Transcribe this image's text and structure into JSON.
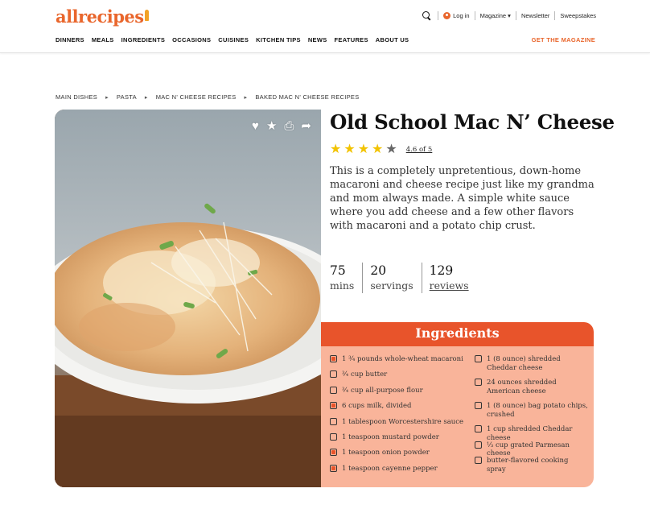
{
  "brand": {
    "logo_text": "allrecipes"
  },
  "top_links": {
    "login": "Log in",
    "magazine": "Magazine ▾",
    "newsletter": "Newsletter",
    "sweepstakes": "Sweepstakes"
  },
  "nav": [
    "DINNERS",
    "MEALS",
    "INGREDIENTS",
    "OCCASIONS",
    "CUISINES",
    "KITCHEN TIPS",
    "NEWS",
    "FEATURES",
    "ABOUT US"
  ],
  "get_magazine": "GET THE MAGAZINE",
  "breadcrumb": [
    "MAIN DISHES",
    "PASTA",
    "MAC N' CHEESE RECIPES",
    "BAKED MAC N' CHEESE RECIPES"
  ],
  "recipe": {
    "title": "Old School Mac N’ Cheese",
    "rating_value": 4.6,
    "rating_text": "4.6 of 5",
    "description": "This is a completely unpretentious, down-home macaroni and cheese recipe just like my grandma and mom always made. A simple white sauce where you add cheese and a few other flavors with macaroni and a potato chip crust.",
    "stats": [
      {
        "num": "75",
        "label": "mins"
      },
      {
        "num": "20",
        "label": "servings"
      },
      {
        "num": "129",
        "label": "reviews"
      }
    ]
  },
  "photo_actions": {
    "favorite": "heart-icon",
    "rate": "star-icon",
    "print": "print-icon",
    "share": "share-icon"
  },
  "ingredients": {
    "heading": "Ingredients",
    "left": [
      {
        "text": "1 ¾ pounds whole-wheat macaroni",
        "checked": true
      },
      {
        "text": "¾ cup butter",
        "checked": false
      },
      {
        "text": "¾ cup all-purpose flour",
        "checked": false
      },
      {
        "text": "6 cups milk, divided",
        "checked": true
      },
      {
        "text": "1 tablespoon Worcestershire sauce",
        "checked": false
      },
      {
        "text": "1 teaspoon mustard powder",
        "checked": false
      },
      {
        "text": "1 teaspoon onion powder",
        "checked": true
      },
      {
        "text": "1 teaspoon cayenne pepper",
        "checked": true
      }
    ],
    "right": [
      {
        "text": "1 (8 ounce) shredded Cheddar cheese",
        "checked": false
      },
      {
        "text": "24 ounces shredded American cheese",
        "checked": false
      },
      {
        "text": "1 (8 ounce) bag potato chips, crushed",
        "checked": false
      },
      {
        "text": "1 cup shredded Cheddar cheese",
        "checked": false
      },
      {
        "text": "⅓ cup grated Parmesan cheese",
        "checked": false
      },
      {
        "text": "butter-flavored cooking spray",
        "checked": false
      }
    ]
  },
  "colors": {
    "brand_orange": "#e9662c",
    "ingredient_header": "#e8542b",
    "ingredient_bg": "#f9b49a",
    "star": "#f2c300"
  }
}
